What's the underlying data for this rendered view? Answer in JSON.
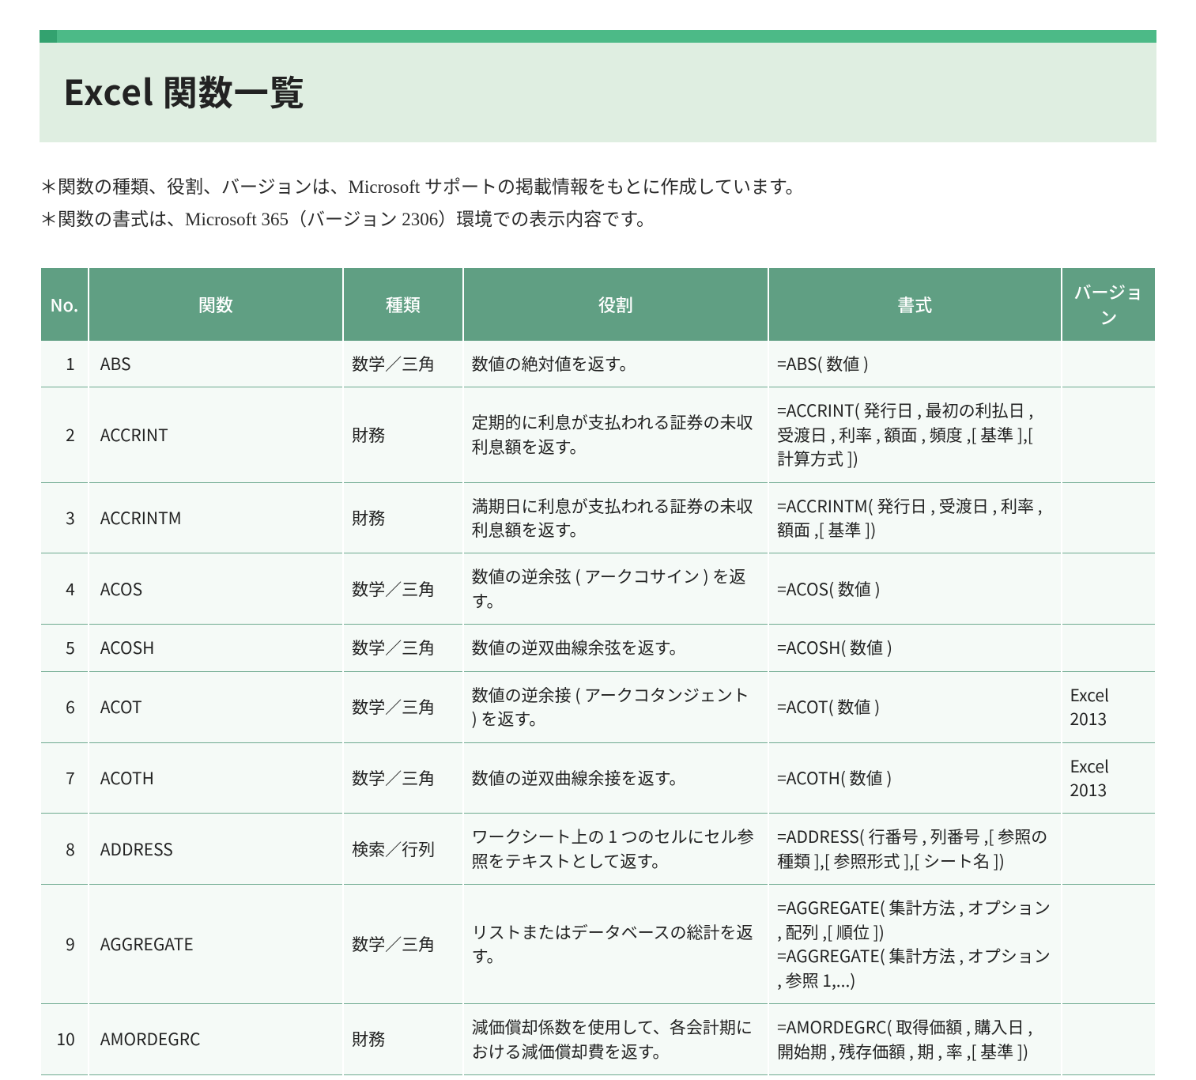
{
  "title": "Excel 関数一覧",
  "notes": [
    "＊関数の種類、役割、バージョンは、Microsoft サポートの掲載情報をもとに作成しています。",
    "＊関数の書式は、Microsoft 365（バージョン 2306）環境での表示内容です。"
  ],
  "table": {
    "headers": {
      "no": "No.",
      "function": "関数",
      "category": "種類",
      "role": "役割",
      "formula": "書式",
      "version": "バージョン"
    },
    "rows": [
      {
        "no": "1",
        "function": "ABS",
        "category": "数学／三角",
        "role": "数値の絶対値を返す。",
        "formula": "=ABS( 数値 )",
        "version": ""
      },
      {
        "no": "2",
        "function": "ACCRINT",
        "category": "財務",
        "role": "定期的に利息が支払われる証券の未収利息額を返す。",
        "formula": "=ACCRINT( 発行日 , 最初の利払日 , 受渡日 , 利率 , 額面 , 頻度 ,[ 基準 ],[ 計算方式 ])",
        "version": ""
      },
      {
        "no": "3",
        "function": "ACCRINTM",
        "category": "財務",
        "role": "満期日に利息が支払われる証券の未収利息額を返す。",
        "formula": "=ACCRINTM( 発行日 , 受渡日 , 利率 , 額面 ,[ 基準 ])",
        "version": ""
      },
      {
        "no": "4",
        "function": "ACOS",
        "category": "数学／三角",
        "role": "数値の逆余弦 ( アークコサイン ) を返す。",
        "formula": "=ACOS( 数値 )",
        "version": ""
      },
      {
        "no": "5",
        "function": "ACOSH",
        "category": "数学／三角",
        "role": "数値の逆双曲線余弦を返す。",
        "formula": "=ACOSH( 数値 )",
        "version": ""
      },
      {
        "no": "6",
        "function": "ACOT",
        "category": "数学／三角",
        "role": "数値の逆余接 ( アークコタンジェント ) を返す。",
        "formula": "=ACOT( 数値 )",
        "version": "Excel 2013"
      },
      {
        "no": "7",
        "function": "ACOTH",
        "category": "数学／三角",
        "role": "数値の逆双曲線余接を返す。",
        "formula": "=ACOTH( 数値 )",
        "version": "Excel 2013"
      },
      {
        "no": "8",
        "function": "ADDRESS",
        "category": "検索／行列",
        "role": "ワークシート上の 1 つのセルにセル参照をテキストとして返す。",
        "formula": "=ADDRESS( 行番号 , 列番号 ,[ 参照の種類 ],[ 参照形式 ],[ シート名 ])",
        "version": ""
      },
      {
        "no": "9",
        "function": "AGGREGATE",
        "category": "数学／三角",
        "role": "リストまたはデータベースの総計を返す。",
        "formula": "=AGGREGATE( 集計方法 , オプション , 配列 ,[ 順位 ])\n=AGGREGATE( 集計方法 , オプション , 参照 1,...)",
        "version": ""
      },
      {
        "no": "10",
        "function": "AMORDEGRC",
        "category": "財務",
        "role": "減価償却係数を使用して、各会計期における減価償却費を返す。",
        "formula": "=AMORDEGRC( 取得価額 , 購入日 , 開始期 , 残存価額 , 期 , 率 ,[ 基準 ])",
        "version": ""
      }
    ]
  }
}
